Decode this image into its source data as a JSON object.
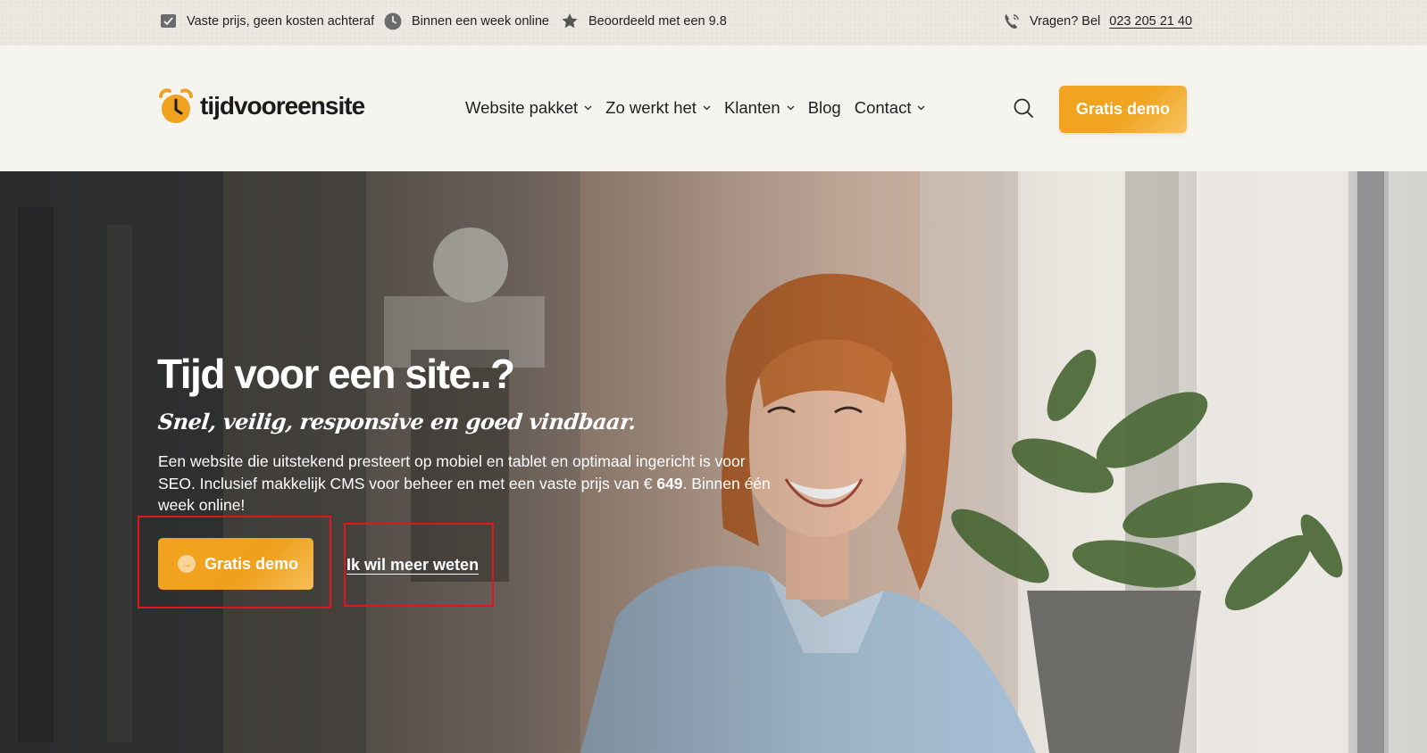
{
  "topbar": {
    "usps": [
      {
        "icon": "price-tag-icon",
        "text": "Vaste prijs, geen kosten achteraf"
      },
      {
        "icon": "clock-icon",
        "text": "Binnen een week online"
      },
      {
        "icon": "star-badge-icon",
        "text": "Beoordeeld met een 9.8"
      }
    ],
    "contact_label": "Vragen? Bel",
    "phone": "023 205 21 40"
  },
  "header": {
    "logo_text": "tijdvooreensite",
    "nav": [
      {
        "label": "Website pakket",
        "has_dropdown": true
      },
      {
        "label": "Zo werkt het",
        "has_dropdown": true
      },
      {
        "label": "Klanten",
        "has_dropdown": true
      },
      {
        "label": "Blog",
        "has_dropdown": false
      },
      {
        "label": "Contact",
        "has_dropdown": true
      }
    ],
    "cta_label": "Gratis demo"
  },
  "hero": {
    "title": "Tijd voor een site..?",
    "tagline": "Snel, veilig, responsive en goed vindbaar.",
    "description_pre": "Een website die uitstekend presteert op mobiel en tablet en optimaal ingericht is voor SEO. Inclusief makkelijk CMS voor beheer en met een vaste prijs van € ",
    "price": "649",
    "description_post": ". Binnen één week online!",
    "primary_cta": "Gratis demo",
    "secondary_cta": "Ik wil meer weten"
  },
  "colors": {
    "accent": "#f2a31f",
    "annotation": "#e0161a"
  }
}
